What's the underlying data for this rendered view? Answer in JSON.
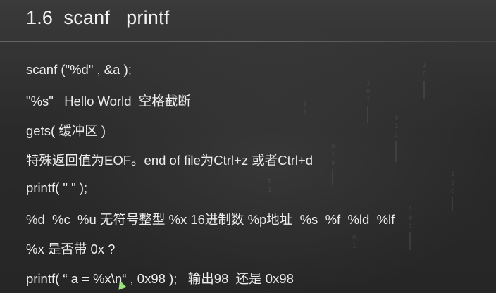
{
  "slide": {
    "title": "1.6  scanf   printf",
    "lines": [
      "scanf (\"%d\" , &a );",
      "\"%s\"   Hello World  空格截断",
      "gets( 缓冲区 )",
      "特殊返回值为EOF。end of file为Ctrl+z 或者Ctrl+d",
      "printf( \" \" );",
      "%d  %c  %u 无符号整型 %x 16进制数 %p地址  %s  %f  %ld  %lf",
      "%x 是否带 0x ?",
      "printf( “ a = %x\\n“ , 0x98 );   输出98  还是 0x98"
    ]
  },
  "colors": {
    "background": "#2b2b2b",
    "text": "#ededed",
    "cursor": "#9be07c"
  },
  "icons": {
    "cursor": "mouse-pointer-icon"
  }
}
